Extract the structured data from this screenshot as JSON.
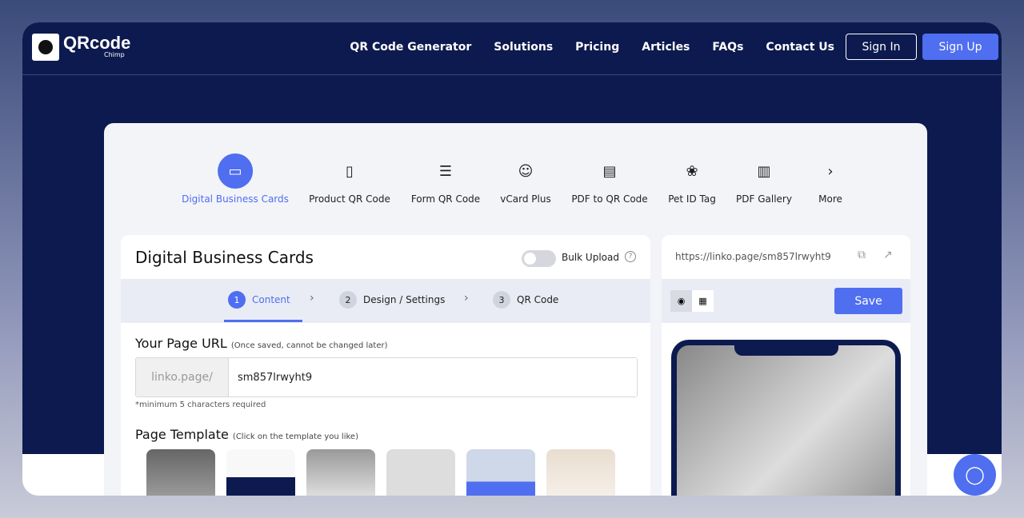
{
  "brand": {
    "name": "QRcode",
    "sub": "Chimp"
  },
  "nav": {
    "items": [
      "QR Code Generator",
      "Solutions",
      "Pricing",
      "Articles",
      "FAQs",
      "Contact Us"
    ],
    "sign_in": "Sign In",
    "sign_up": "Sign Up"
  },
  "types": [
    {
      "label": "Digital Business Cards",
      "icon": "card-icon",
      "active": true
    },
    {
      "label": "Product QR Code",
      "icon": "product-icon"
    },
    {
      "label": "Form QR Code",
      "icon": "form-icon"
    },
    {
      "label": "vCard Plus",
      "icon": "vcard-icon"
    },
    {
      "label": "PDF to QR Code",
      "icon": "pdf-icon"
    },
    {
      "label": "Pet ID Tag",
      "icon": "paw-icon"
    },
    {
      "label": "PDF Gallery",
      "icon": "pdf-gallery-icon"
    },
    {
      "label": "More",
      "icon": "chevron-right-icon"
    }
  ],
  "panel": {
    "title": "Digital Business Cards",
    "bulk": "Bulk Upload",
    "help": "?",
    "steps": [
      {
        "n": "1",
        "label": "Content"
      },
      {
        "n": "2",
        "label": "Design / Settings"
      },
      {
        "n": "3",
        "label": "QR Code"
      }
    ],
    "url_label": "Your Page URL",
    "url_note": "(Once saved, cannot be changed later)",
    "url_prefix": "linko.page/",
    "url_value": "sm857lrwyht9",
    "url_hint": "*minimum 5 characters required",
    "tpl_label": "Page Template",
    "tpl_note": "(Click on the template you like)"
  },
  "preview": {
    "url": "https://linko.page/sm857lrwyht9",
    "save": "Save"
  },
  "colors": {
    "accent": "#4f6ef0",
    "navy": "#0d1a4f"
  }
}
